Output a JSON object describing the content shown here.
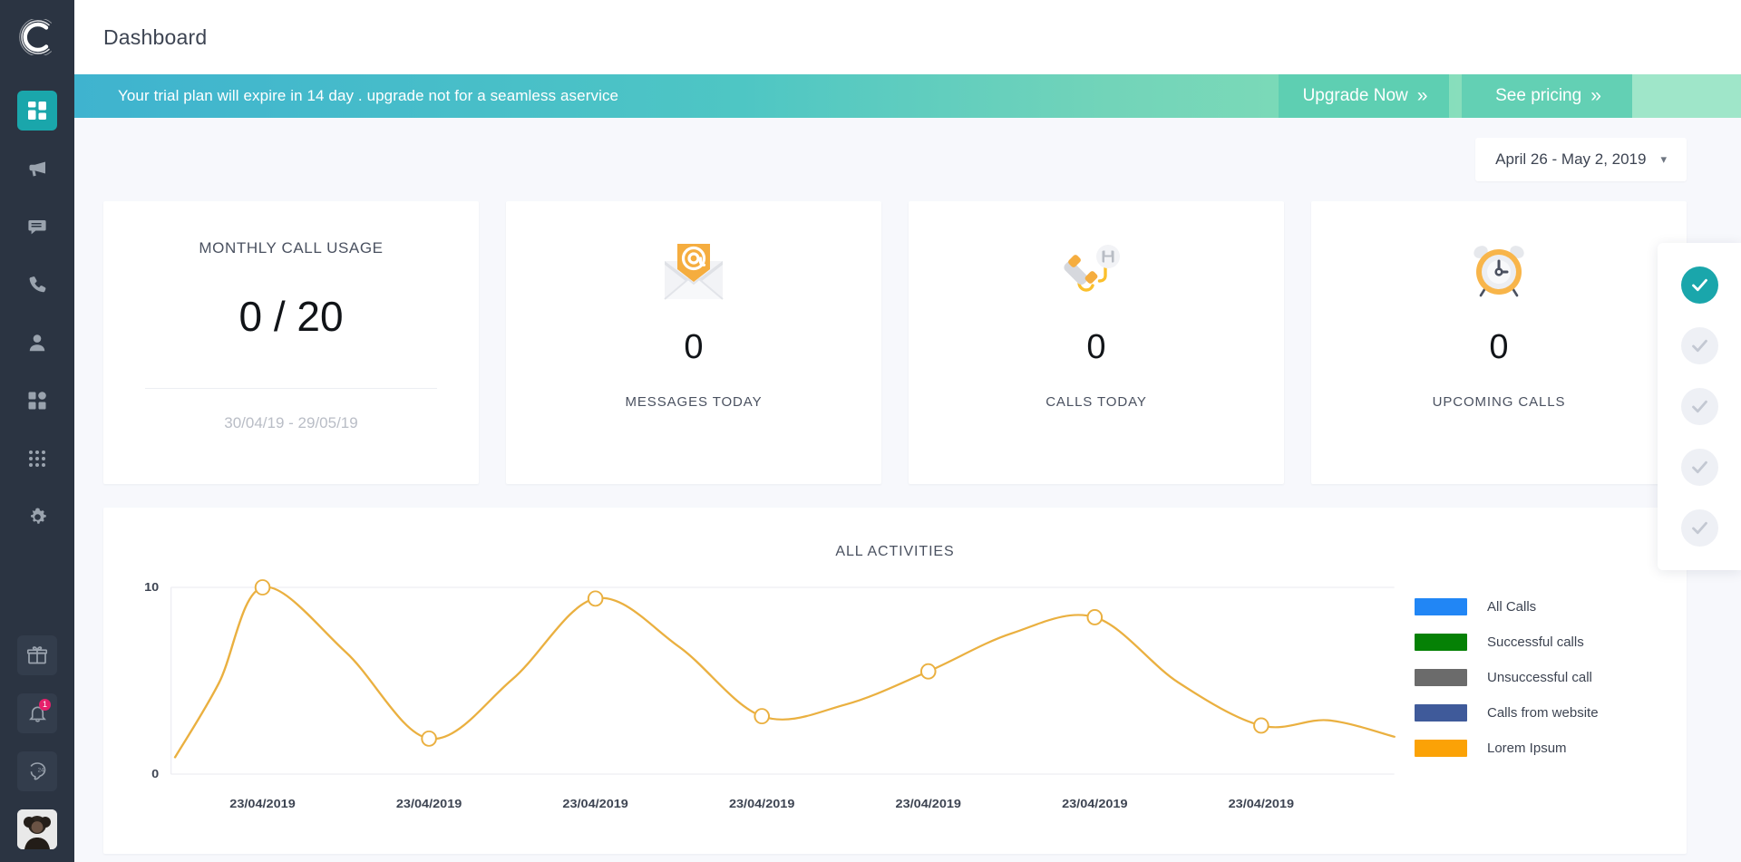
{
  "sidebar": {
    "logo_icon": "circular-c-logo",
    "top_items": [
      {
        "icon": "dashboard-grid-icon",
        "name": "dashboard",
        "active": true
      },
      {
        "icon": "megaphone-icon",
        "name": "campaigns",
        "active": false
      },
      {
        "icon": "chat-bubble-icon",
        "name": "messages",
        "active": false
      },
      {
        "icon": "phone-handset-icon",
        "name": "calls",
        "active": false
      },
      {
        "icon": "user-icon",
        "name": "contacts",
        "active": false
      },
      {
        "icon": "apps-squares-icon",
        "name": "integrations",
        "active": false
      },
      {
        "icon": "dots-grid-icon",
        "name": "keypad",
        "active": false
      },
      {
        "icon": "gear-icon",
        "name": "settings",
        "active": false
      }
    ],
    "bottom_items": [
      {
        "icon": "gift-icon",
        "name": "rewards",
        "badge": ""
      },
      {
        "icon": "bell-icon",
        "name": "notifications",
        "badge": "1"
      },
      {
        "icon": "support-24-icon",
        "name": "support",
        "badge": ""
      },
      {
        "icon": "avatar-icon",
        "name": "profile",
        "badge": ""
      }
    ]
  },
  "header": {
    "title": "Dashboard"
  },
  "banner": {
    "message": "Your trial plan will expire in 14 day . upgrade  not for a seamless aservice",
    "upgrade_label": "Upgrade Now",
    "pricing_label": "See pricing",
    "chevron": "››"
  },
  "filter": {
    "date_range": "April 26 - May 2, 2019",
    "caret_icon": "chevron-down-icon"
  },
  "cards": {
    "usage": {
      "title": "MONTHLY CALL USAGE",
      "value": "0 / 20",
      "range": "30/04/19 - 29/05/19"
    },
    "metrics": [
      {
        "icon": "email-at-envelope-icon",
        "value": "0",
        "label": "MESSAGES TODAY"
      },
      {
        "icon": "phone-save-icon",
        "value": "0",
        "label": "CALLS TODAY"
      },
      {
        "icon": "alarm-clock-icon",
        "value": "0",
        "label": "UPCOMING CALLS"
      }
    ]
  },
  "chart_data": {
    "type": "line",
    "title": "ALL ACTIVITIES",
    "xlabel": "",
    "ylabel": "",
    "ylim": [
      0,
      10
    ],
    "yticks": [
      "0",
      "10"
    ],
    "grid": true,
    "legend_position": "right",
    "line_color": "#eab040",
    "categories": [
      "23/04/2019",
      "23/04/2019",
      "23/04/2019",
      "23/04/2019",
      "23/04/2019",
      "23/04/2019",
      "23/04/2019"
    ],
    "series": [
      {
        "name": "Lorem Ipsum",
        "color": "#eab040",
        "values": [
          10.0,
          1.9,
          9.4,
          3.1,
          5.5,
          8.4,
          2.6
        ]
      }
    ],
    "markers": [
      {
        "x": "23/04/2019",
        "y": 10.0
      },
      {
        "x": "23/04/2019",
        "y": 1.9
      },
      {
        "x": "23/04/2019",
        "y": 9.4
      },
      {
        "x": "23/04/2019",
        "y": 3.1
      },
      {
        "x": "23/04/2019",
        "y": 5.5
      },
      {
        "x": "23/04/2019",
        "y": 8.4
      },
      {
        "x": "23/04/2019",
        "y": 2.6
      }
    ],
    "legend": [
      {
        "label": "All Calls",
        "color": "#2186f5"
      },
      {
        "label": "Successful calls",
        "color": "#058105"
      },
      {
        "label": "Unsuccessful call",
        "color": "#6b6b6b"
      },
      {
        "label": "Calls from website",
        "color": "#3f5a9a"
      },
      {
        "label": "Lorem Ipsum",
        "color": "#fba206"
      }
    ]
  },
  "checklist": {
    "accent_color": "#1aa6ab",
    "items": [
      {
        "name": "step-1",
        "state": "done",
        "icon": "check-icon"
      },
      {
        "name": "step-2",
        "state": "pending",
        "icon": "check-icon"
      },
      {
        "name": "step-3",
        "state": "pending",
        "icon": "check-icon"
      },
      {
        "name": "step-4",
        "state": "pending",
        "icon": "check-icon"
      },
      {
        "name": "step-5",
        "state": "pending",
        "icon": "check-icon"
      }
    ]
  }
}
